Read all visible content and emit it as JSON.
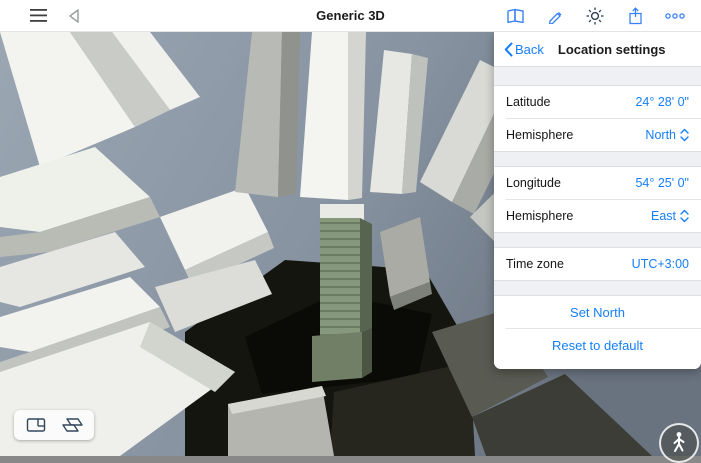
{
  "toolbar": {
    "title": "Generic 3D"
  },
  "panel": {
    "back_label": "Back",
    "title": "Location settings",
    "fields": {
      "latitude": {
        "label": "Latitude",
        "value": "24° 28' 0\""
      },
      "lat_hemisphere": {
        "label": "Hemisphere",
        "value": "North"
      },
      "longitude": {
        "label": "Longitude",
        "value": "54° 25' 0\""
      },
      "lon_hemisphere": {
        "label": "Hemisphere",
        "value": "East"
      },
      "timezone": {
        "label": "Time zone",
        "value": "UTC+3:00"
      }
    },
    "buttons": {
      "set_north": "Set North",
      "reset": "Reset to default"
    }
  },
  "colors": {
    "accent": "#157efb",
    "panel_bg": "#ffffff",
    "spacer_bg": "#eef0f3"
  }
}
